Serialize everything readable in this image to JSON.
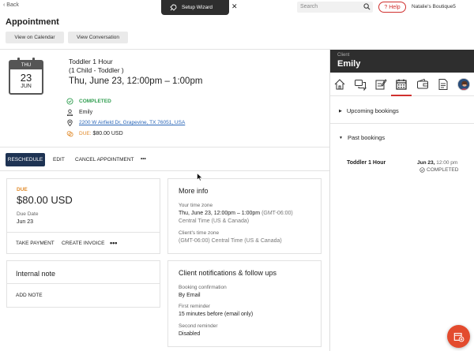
{
  "topbar": {
    "back_label": "Back",
    "wizard_label": "Setup Wizard",
    "search_placeholder": "Search",
    "help_label": "Help",
    "business_name": "Natalie's Boutique5"
  },
  "header": {
    "title": "Appointment",
    "view_calendar": "View on Calendar",
    "view_conversation": "View Conversation"
  },
  "appointment": {
    "cal_day_of_week": "THU",
    "cal_day": "23",
    "cal_month": "JUN",
    "service_line1": "Toddler 1 Hour",
    "service_line2": "(1 Child - Toddler )",
    "datetime": "Thu, June 23, 12:00pm – 1:00pm",
    "status": "COMPLETED",
    "client_name": "Emily",
    "address": "2200 W Airfield Dr, Grapevine, TX 76051, USA",
    "due_label": "DUE:",
    "due_amount": "$80.00 USD"
  },
  "actions": {
    "reschedule": "RESCHEDULE",
    "edit": "EDIT",
    "cancel": "CANCEL APPOINTMENT",
    "more": "•••"
  },
  "payment_card": {
    "due_label": "DUE",
    "amount": "$80.00 USD",
    "due_date_label": "Due Date",
    "due_date": "Jun 23",
    "take_payment": "TAKE PAYMENT",
    "create_invoice": "CREATE INVOICE",
    "more": "•••"
  },
  "more_info": {
    "title": "More info",
    "your_tz_label": "Your time zone",
    "your_tz_line1": "Thu, June 23, 12:00pm – 1:00pm",
    "your_tz_line1_suffix": "(GMT-06:00)",
    "your_tz_line2": "Central Time (US & Canada)",
    "client_tz_label": "Client's time zone",
    "client_tz_value": "(GMT-06:00) Central Time (US & Canada)"
  },
  "internal_note": {
    "title": "Internal note",
    "add_note": "ADD NOTE"
  },
  "notifications": {
    "title": "Client notifications & follow ups",
    "booking_label": "Booking confirmation",
    "booking_value": "By Email",
    "first_label": "First reminder",
    "first_value": "15 minutes before (email only)",
    "second_label": "Second reminder",
    "second_value": "Disabled"
  },
  "client_panel": {
    "client_label": "Client",
    "client_name": "Emily",
    "upcoming": "Upcoming bookings",
    "past": "Past bookings",
    "past_item_title": "Toddler 1 Hour",
    "past_item_date": "Jun 23,",
    "past_item_time": "12:00 pm",
    "past_item_status": "COMPLETED"
  },
  "colors": {
    "accent_red": "#d0302f",
    "primary_navy": "#1e3353",
    "success_green": "#2f9d4f",
    "due_orange": "#e08a2a",
    "panel_dark": "#2e2e2e",
    "fab": "#e34b2e"
  }
}
